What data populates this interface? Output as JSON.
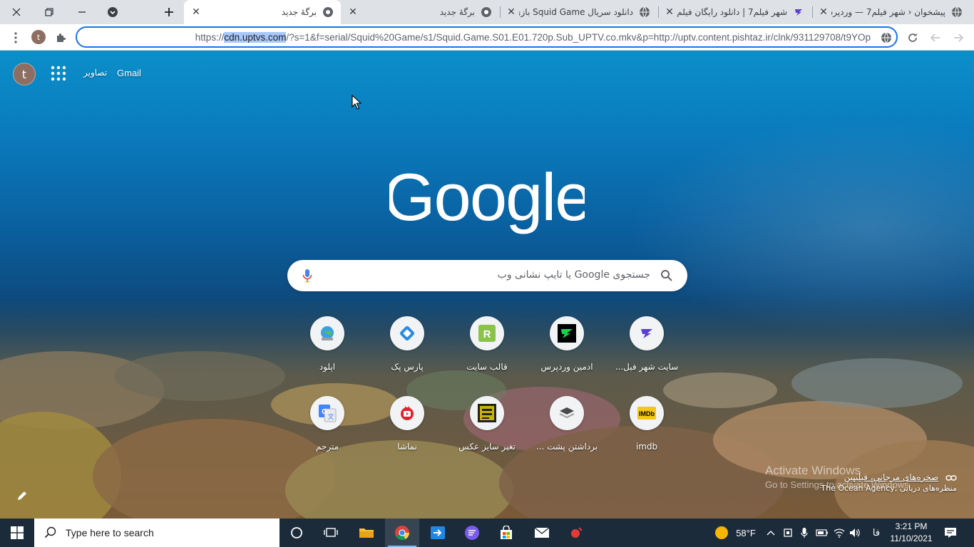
{
  "browser": {
    "tabs": [
      {
        "title": "برگهٔ جدید",
        "active": true
      },
      {
        "title": "برگهٔ جدید",
        "active": false
      },
      {
        "title": "دانلود سریال Squid Game بازی",
        "active": false
      },
      {
        "title": "شهر فیلم7 | دانلود رایگان فیلم",
        "active": false
      },
      {
        "title": "پیشخوان ‹ شهر فیلم7 — وردپرس",
        "active": false
      }
    ],
    "url_prefix": "https://",
    "url_domain": "cdn.uptvs.com",
    "url_rest": "/?s=1&f=serial/Squid%20Game/s1/Squid.Game.S01.E01.720p.Sub_UPTV.co.mkv&p=http://uptv.content.pishtaz.ir/clnk/931129708/t9YOp",
    "profile_initial": "t"
  },
  "ntp": {
    "profile_initial": "t",
    "images_link": "تصاویر",
    "gmail_link": "Gmail",
    "logo_text": "Google",
    "search_placeholder": "جستجوی Google یا تایپ نشانی وب",
    "shortcuts": [
      {
        "label": "سایت شهر فیل...",
        "icon": "shahrfilm-icon"
      },
      {
        "label": "ادمین وردپرس",
        "icon": "wp-admin-icon"
      },
      {
        "label": "قالب سایت",
        "icon": "theme-site-icon"
      },
      {
        "label": "پارس پک",
        "icon": "parspack-icon"
      },
      {
        "label": "اپلود",
        "icon": "upload-globe-icon"
      },
      {
        "label": "imdb",
        "icon": "imdb-icon"
      },
      {
        "label": "برداشتن پشت ...",
        "icon": "layers-icon"
      },
      {
        "label": "تغیر سایز عکس",
        "icon": "resize-image-icon"
      },
      {
        "label": "نماشا",
        "icon": "namasha-icon"
      },
      {
        "label": "مترجم",
        "icon": "translate-icon"
      }
    ],
    "attribution_title": "صخره‌های مرجانی، فیلیپین",
    "attribution_credit": "The Ocean Agency, منظره‌های دریایی",
    "watermark_line1": "Activate Windows",
    "watermark_line2": "Go to Settings to activate Windows."
  },
  "taskbar": {
    "search_placeholder": "Type here to search",
    "weather": "58°F",
    "language": "فا",
    "time": "3:21 PM",
    "date": "11/10/2021"
  },
  "colors": {
    "accent": "#1a73e8",
    "url_selection": "#a8c7fa",
    "taskbar": "#1c2b3a"
  }
}
